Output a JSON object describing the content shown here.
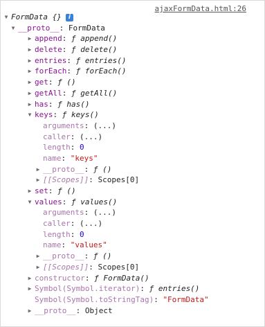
{
  "source_link": "ajaxFormData.html:26",
  "root": {
    "label": "FormData {}",
    "info_icon": "i"
  },
  "proto": {
    "key": "__proto__",
    "value": "FormData"
  },
  "rows": {
    "append": {
      "key": "append",
      "value": "append()"
    },
    "delete": {
      "key": "delete",
      "value": "delete()"
    },
    "entries": {
      "key": "entries",
      "value": "entries()"
    },
    "forEach": {
      "key": "forEach",
      "value": "forEach()"
    },
    "get": {
      "key": "get",
      "value": "()"
    },
    "getAll": {
      "key": "getAll",
      "value": "getAll()"
    },
    "has": {
      "key": "has",
      "value": "has()"
    },
    "keys": {
      "key": "keys",
      "value": "keys()",
      "arguments": {
        "key": "arguments",
        "value": "(...)"
      },
      "caller": {
        "key": "caller",
        "value": "(...)"
      },
      "length": {
        "key": "length",
        "value": "0"
      },
      "name": {
        "key": "name",
        "value": "\"keys\""
      },
      "proto": {
        "key": "__proto__",
        "value": "()"
      },
      "scopes": {
        "key": "[[Scopes]]",
        "value": "Scopes[0]"
      }
    },
    "set": {
      "key": "set",
      "value": "()"
    },
    "values": {
      "key": "values",
      "value": "values()",
      "arguments": {
        "key": "arguments",
        "value": "(...)"
      },
      "caller": {
        "key": "caller",
        "value": "(...)"
      },
      "length": {
        "key": "length",
        "value": "0"
      },
      "name": {
        "key": "name",
        "value": "\"values\""
      },
      "proto": {
        "key": "__proto__",
        "value": "()"
      },
      "scopes": {
        "key": "[[Scopes]]",
        "value": "Scopes[0]"
      }
    },
    "constructor": {
      "key": "constructor",
      "value": "FormData()"
    },
    "iterator": {
      "key": "Symbol(Symbol.iterator)",
      "value": "entries()"
    },
    "toStringTag": {
      "key": "Symbol(Symbol.toStringTag)",
      "value": "\"FormData\""
    },
    "proto_obj": {
      "key": "__proto__",
      "value": "Object"
    }
  },
  "glyphs": {
    "f": "ƒ",
    "expanded": "▼",
    "collapsed": "▶"
  },
  "colors": {
    "key": "#881391",
    "number": "#1c00cf",
    "string": "#c41a16",
    "info": "#3b82d6"
  }
}
